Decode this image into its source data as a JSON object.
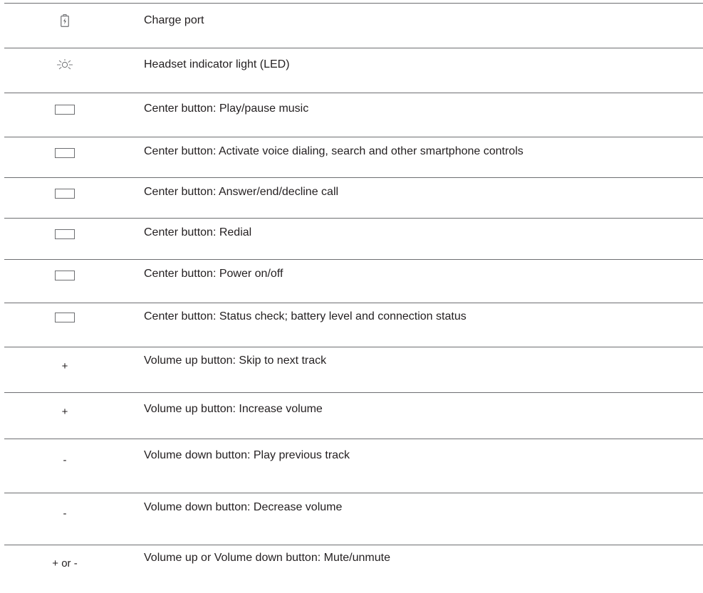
{
  "rows": [
    {
      "kind": "svg-battery",
      "icon": "charge-port-icon",
      "label": "Charge port"
    },
    {
      "kind": "svg-led",
      "icon": "led-indicator-icon",
      "label": "Headset indicator light (LED)"
    },
    {
      "kind": "rect",
      "icon": "center-button-icon",
      "label": "Center button: Play/pause music"
    },
    {
      "kind": "rect",
      "icon": "center-button-icon",
      "label": "Center button: Activate voice dialing, search and other smartphone controls"
    },
    {
      "kind": "rect",
      "icon": "center-button-icon",
      "label": "Center button: Answer/end/decline call"
    },
    {
      "kind": "rect",
      "icon": "center-button-icon",
      "label": "Center button: Redial"
    },
    {
      "kind": "rect",
      "icon": "center-button-icon",
      "label": "Center button: Power on/off"
    },
    {
      "kind": "rect",
      "icon": "center-button-icon",
      "label": "Center button: Status check; battery level and connection status"
    },
    {
      "kind": "text",
      "icon": "plus-icon",
      "symbol": "+",
      "label": "Volume up button: Skip to next track"
    },
    {
      "kind": "text",
      "icon": "plus-icon",
      "symbol": "+",
      "label": "Volume up button: Increase volume"
    },
    {
      "kind": "text",
      "icon": "minus-icon",
      "symbol": "-",
      "label": "Volume down button: Play previous track"
    },
    {
      "kind": "text",
      "icon": "minus-icon",
      "symbol": "-",
      "label": "Volume down button: Decrease volume"
    },
    {
      "kind": "text",
      "icon": "plus-or-minus-icon",
      "symbol": "+ or -",
      "label": "Volume up or Volume down button: Mute/unmute"
    }
  ]
}
